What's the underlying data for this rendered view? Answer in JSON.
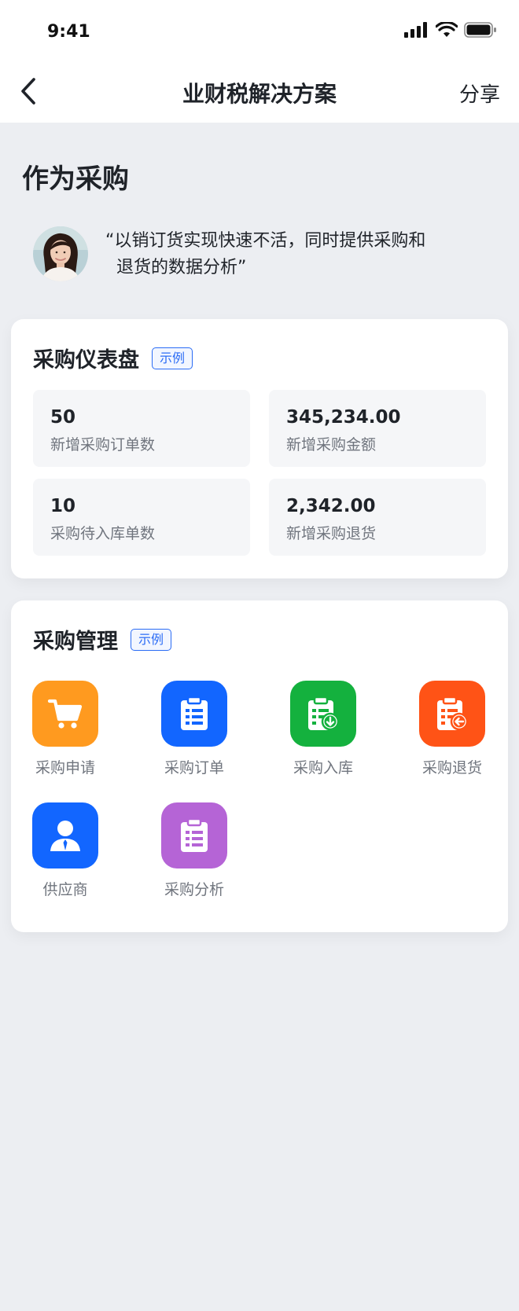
{
  "status": {
    "time": "9:41"
  },
  "nav": {
    "title": "业财税解决方案",
    "share_label": "分享"
  },
  "role": {
    "title": "作为采购",
    "quote_line1": "“以销订货实现快速不活，同时提供采购和",
    "quote_line2": "退货的数据分析”"
  },
  "dashboard": {
    "title": "采购仪表盘",
    "tag": "示例",
    "stats": [
      {
        "value": "50",
        "label": "新增采购订单数"
      },
      {
        "value": "345,234.00",
        "label": "新增采购金额"
      },
      {
        "value": "10",
        "label": "采购待入库单数"
      },
      {
        "value": "2,342.00",
        "label": "新增采购退货"
      }
    ]
  },
  "management": {
    "title": "采购管理",
    "tag": "示例",
    "apps": [
      {
        "label": "采购申请",
        "icon": "cart-icon",
        "color": "#ff9a1f"
      },
      {
        "label": "采购订单",
        "icon": "clipboard-list-icon",
        "color": "#1266ff"
      },
      {
        "label": "采购入库",
        "icon": "clipboard-inbound-icon",
        "color": "#14b13e"
      },
      {
        "label": "采购退货",
        "icon": "clipboard-return-icon",
        "color": "#ff5316"
      },
      {
        "label": "供应商",
        "icon": "supplier-person-icon",
        "color": "#1266ff"
      },
      {
        "label": "采购分析",
        "icon": "clipboard-analysis-icon",
        "color": "#b564d6"
      }
    ]
  }
}
